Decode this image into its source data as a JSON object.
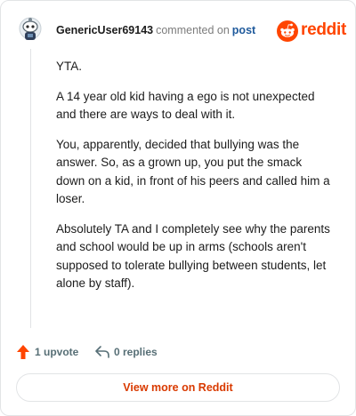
{
  "header": {
    "username": "GenericUser69143",
    "commented_text": "commented on",
    "post_link": "post",
    "logo_text": "reddit"
  },
  "comment": {
    "paragraphs": [
      "YTA.",
      "A 14 year old kid having a ego is not unexpected and there are ways to deal with it.",
      "You, apparently, decided that bullying was the answer. So, as a grown up, you put the smack down on a kid, in front of his peers and called him a loser.",
      "Absolutely TA and I completely see why the parents and school would be up in arms (schools aren't supposed to tolerate bullying between students, let alone by staff)."
    ]
  },
  "actions": {
    "upvote_label": "1 upvote",
    "reply_label": "0 replies"
  },
  "footer": {
    "view_more_label": "View more on Reddit"
  },
  "colors": {
    "brand": "#ff4500",
    "link": "#1f5a9c",
    "cta": "#d93a00"
  },
  "icons": {
    "avatar": "snoo-avatar",
    "logo": "reddit-snoo-icon",
    "upvote": "upvote-arrow-icon",
    "reply": "reply-arrow-icon"
  }
}
